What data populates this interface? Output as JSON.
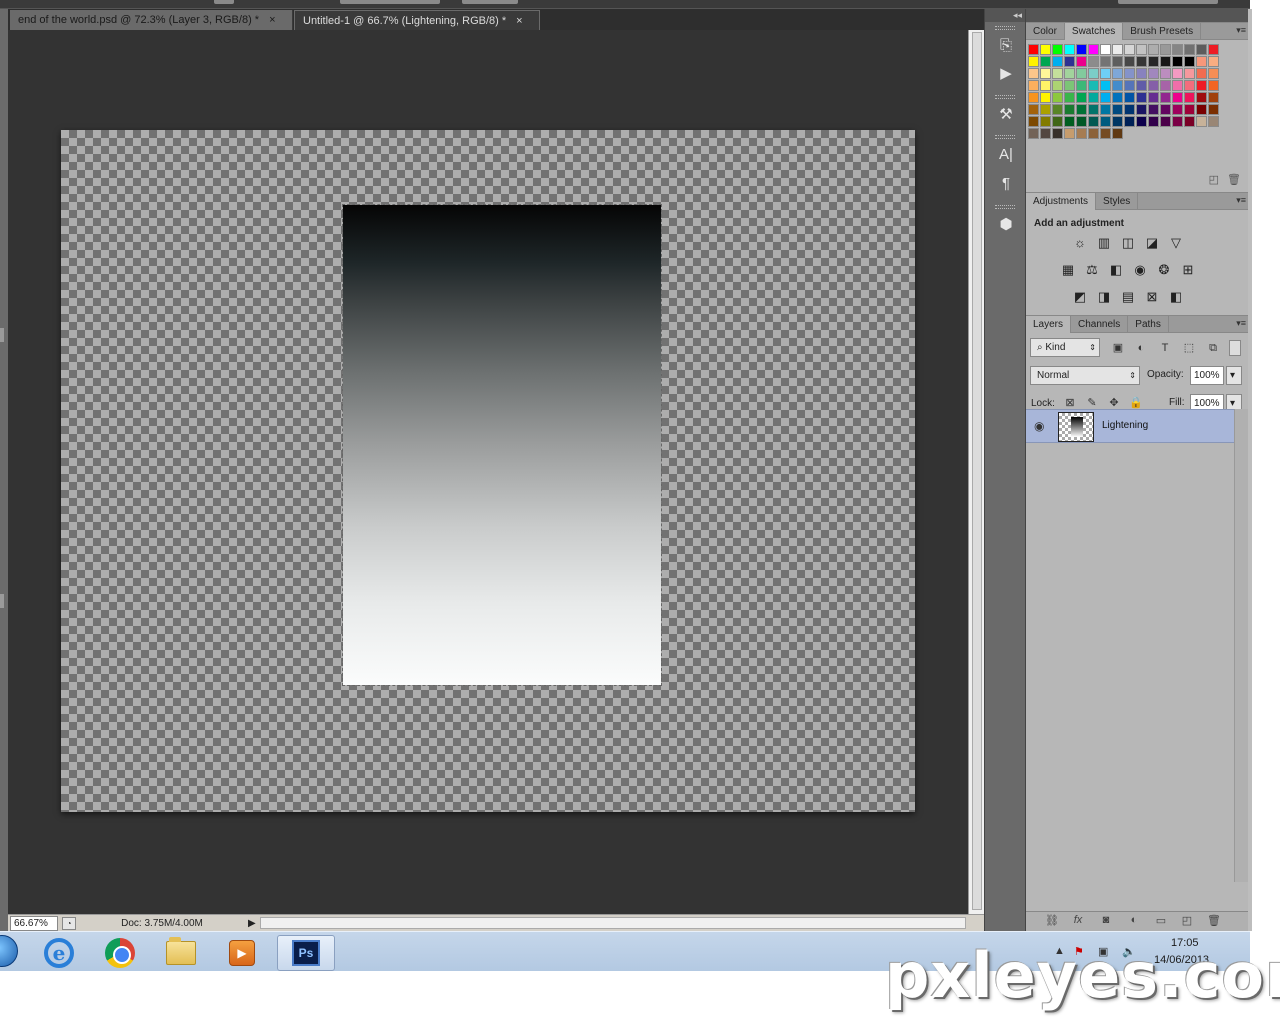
{
  "tabs": [
    {
      "title": "end of the world.psd @ 72.3% (Layer 3, RGB/8) *",
      "close": "×"
    },
    {
      "title": "Untitled-1 @ 66.7% (Lightening, RGB/8) *",
      "close": "×"
    }
  ],
  "status": {
    "zoom": "66.67%",
    "doc": "Doc: 3.75M/4.00M",
    "arrow": "▶"
  },
  "dock": {
    "collapse": "◂◂"
  },
  "color_panel": {
    "tabs": [
      "Color",
      "Swatches",
      "Brush Presets"
    ],
    "active_tab": "Swatches",
    "swatches": [
      [
        "#ff0000",
        "#ffff00",
        "#00ff00",
        "#00ffff",
        "#0000ff",
        "#ff00ff",
        "#ffffff",
        "#ebebeb",
        "#d6d6d6",
        "#c2c2c2",
        "#adadad",
        "#999999",
        "#858585",
        "#707070",
        "#5c5c5c",
        "#ed1c24"
      ],
      [
        "#fff200",
        "#00a651",
        "#00aeef",
        "#2e3192",
        "#ec008c",
        "#8c8c8c",
        "#747474",
        "#5e5e5e",
        "#474747",
        "#363636",
        "#262626",
        "#171717",
        "#000000",
        "#000000",
        "#f7977a",
        "#f9ad81"
      ],
      [
        "#fdc68a",
        "#fff799",
        "#c4df9b",
        "#a2d39c",
        "#82ca9d",
        "#7bcdc8",
        "#6ecff6",
        "#7ea7d8",
        "#8493ca",
        "#8882be",
        "#a187be",
        "#bc8dbf",
        "#f49ac2",
        "#f6989d",
        "#f26c4f",
        "#f68e55"
      ],
      [
        "#fbaf5d",
        "#fff467",
        "#acd372",
        "#7cc576",
        "#3bb878",
        "#1abbb4",
        "#00bff3",
        "#438ccb",
        "#5574b9",
        "#605ca8",
        "#855fa8",
        "#a763a8",
        "#f06ea9",
        "#f26d7d",
        "#ed1c24",
        "#f26522"
      ],
      [
        "#f7941d",
        "#fff200",
        "#8dc73f",
        "#39b54a",
        "#00a651",
        "#00a99d",
        "#00aeef",
        "#0072bc",
        "#0054a6",
        "#2e3192",
        "#662d91",
        "#92278f",
        "#ec008c",
        "#ed145b",
        "#9e0b0f",
        "#a0410d"
      ],
      [
        "#a3620a",
        "#aba000",
        "#598527",
        "#197b30",
        "#007236",
        "#00746b",
        "#0076a3",
        "#004a80",
        "#003471",
        "#1b1464",
        "#440e62",
        "#630460",
        "#9e005d",
        "#9e0039",
        "#790000",
        "#7b2e00"
      ],
      [
        "#7d4900",
        "#827b00",
        "#406618",
        "#005e20",
        "#005826",
        "#005952",
        "#005b7f",
        "#003663",
        "#002157",
        "#0d004c",
        "#32004b",
        "#4b0049",
        "#7b0046",
        "#7a0026",
        "#c7b299",
        "#998675"
      ],
      [
        "#736357",
        "#534741",
        "#37302a",
        "#c69c6d",
        "#a67c52",
        "#8c6239",
        "#754c24",
        "#603913"
      ]
    ]
  },
  "adjustments": {
    "tabs": [
      "Adjustments",
      "Styles"
    ],
    "title": "Add an adjustment",
    "icons": [
      [
        "brightness-icon",
        "levels-icon",
        "curves-icon",
        "exposure-icon",
        "vibrance-icon"
      ],
      [
        "hue-saturation-icon",
        "color-balance-icon",
        "black-white-icon",
        "photo-filter-icon",
        "channel-mixer-icon",
        "color-lookup-icon"
      ],
      [
        "invert-icon",
        "posterize-icon",
        "threshold-icon",
        "gradient-map-icon",
        "selective-color-icon"
      ]
    ]
  },
  "layers": {
    "tabs": [
      "Layers",
      "Channels",
      "Paths"
    ],
    "filter_kind": "Kind",
    "blend_mode": "Normal",
    "opacity_label": "Opacity:",
    "opacity": "100%",
    "lock_label": "Lock:",
    "fill_label": "Fill:",
    "fill": "100%",
    "layer_name": "Lightening"
  },
  "taskbar": {
    "time": "17:05",
    "date": "14/06/2013",
    "ps_label": "Ps"
  },
  "watermark": "pxleyes.com"
}
